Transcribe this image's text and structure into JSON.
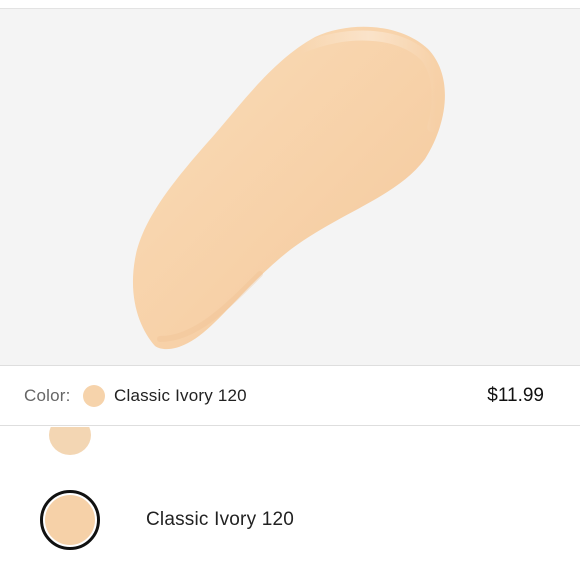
{
  "product_image": {
    "icon": "foundation-swatch-smear",
    "background_color": "#f4f4f4",
    "swatch_color": "#f7d1a8"
  },
  "color_bar": {
    "label": "Color:",
    "selected_name": "Classic Ivory 120",
    "selected_color": "#f6d3ab",
    "price": "$11.99"
  },
  "shade_options": [
    {
      "name": "",
      "color": "#f3d6b3",
      "selected": false
    },
    {
      "name": "Classic Ivory 120",
      "color": "#f6d1a8",
      "selected": true
    }
  ]
}
